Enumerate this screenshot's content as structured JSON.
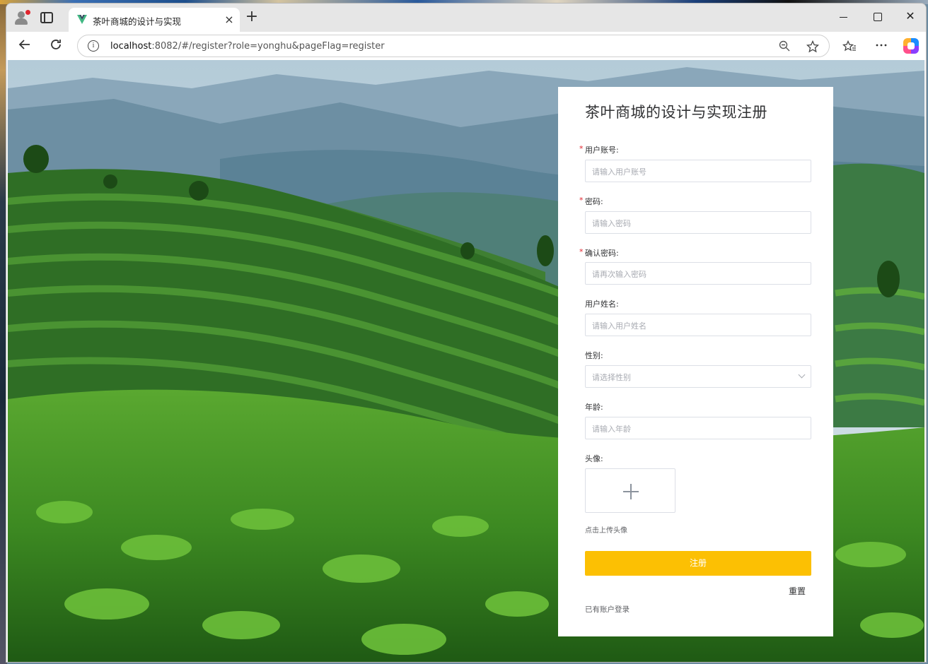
{
  "browser": {
    "tab_title": "茶叶商城的设计与实现",
    "tab_close": "×",
    "new_tab": "+",
    "url_host": "localhost",
    "url_path": ":8082/#/register?role=yonghu&pageFlag=register",
    "info_icon": "i",
    "icons": [
      "profile-icon",
      "tab-actions-icon",
      "vue-favicon",
      "back-arrow-icon",
      "reload-icon",
      "zoom-out-icon",
      "favorite-star-icon",
      "favorites-icon",
      "more-icon",
      "copilot-icon"
    ]
  },
  "window_controls": {
    "close": "✕"
  },
  "register": {
    "title": "茶叶商城的设计与实现注册",
    "required_mark": "*",
    "account_label": "用户账号:",
    "account_placeholder": "请输入用户账号",
    "password_label": "密码:",
    "password_placeholder": "请输入密码",
    "confirm_label": "确认密码:",
    "confirm_placeholder": "请再次输入密码",
    "name_label": "用户姓名:",
    "name_placeholder": "请输入用户姓名",
    "gender_label": "性别:",
    "gender_placeholder": "请选择性别",
    "age_label": "年龄:",
    "age_placeholder": "请输入年龄",
    "avatar_label": "头像:",
    "upload_hint": "点击上传头像",
    "submit": "注册",
    "reset": "重置",
    "login_link": "已有账户登录"
  },
  "colors": {
    "submit_bg": "#fcc003",
    "required": "#e0242d"
  }
}
